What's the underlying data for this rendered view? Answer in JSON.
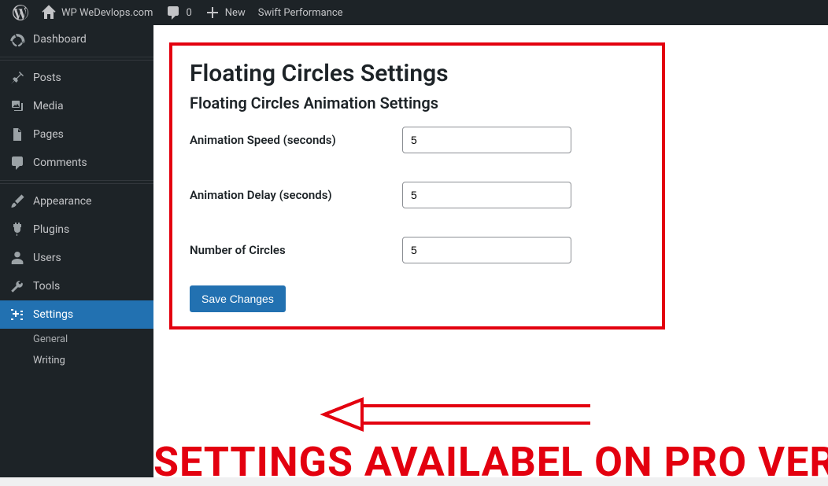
{
  "topbar": {
    "site_name": "WP WeDevlops.com",
    "comments_count": "0",
    "new_label": "New",
    "swift_label": "Swift Performance"
  },
  "sidebar": {
    "items": [
      {
        "label": "Dashboard"
      },
      {
        "label": "Posts"
      },
      {
        "label": "Media"
      },
      {
        "label": "Pages"
      },
      {
        "label": "Comments"
      },
      {
        "label": "Appearance"
      },
      {
        "label": "Plugins"
      },
      {
        "label": "Users"
      },
      {
        "label": "Tools"
      },
      {
        "label": "Settings"
      }
    ],
    "submenu": [
      {
        "label": "General"
      },
      {
        "label": "Writing"
      }
    ]
  },
  "panel": {
    "title": "Floating Circles Settings",
    "subtitle": "Floating Circles Animation Settings",
    "fields": [
      {
        "label": "Animation Speed (seconds)",
        "value": "5"
      },
      {
        "label": "Animation Delay (seconds)",
        "value": "5"
      },
      {
        "label": "Number of Circles",
        "value": "5"
      }
    ],
    "save_label": "Save Changes"
  },
  "annotation": {
    "big_text": "SETTINGS AVAILABEL ON PRO VERSION"
  }
}
